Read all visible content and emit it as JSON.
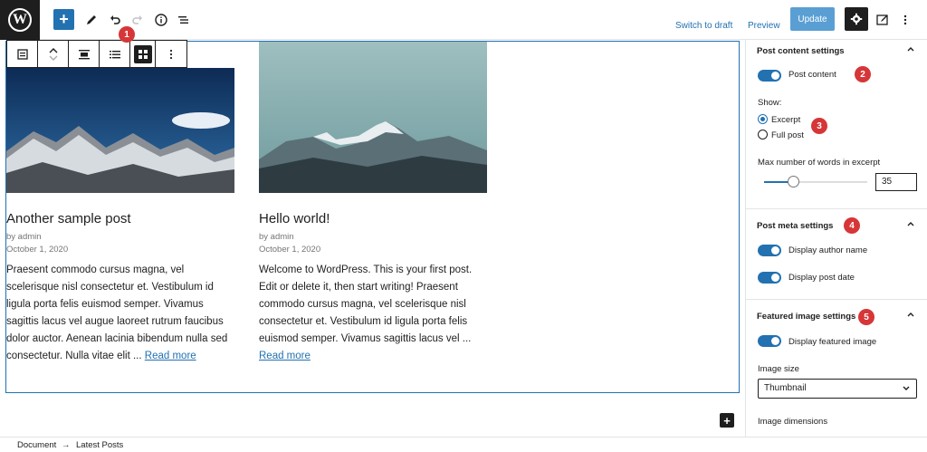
{
  "toolbar": {
    "add_label": "+",
    "switch_to_draft": "Switch to draft",
    "preview": "Preview",
    "update": "Update",
    "logo_letter": "W"
  },
  "posts": [
    {
      "title": "Another sample post",
      "author": "by admin",
      "date": "October 1, 2020",
      "excerpt": "Praesent commodo cursus magna, vel scelerisque nisl consectetur et. Vestibulum id ligula porta felis euismod semper. Vivamus sagittis lacus vel augue laoreet rutrum faucibus dolor auctor. Aenean lacinia bibendum nulla sed consectetur. Nulla vitae elit ... ",
      "read_more": "Read more"
    },
    {
      "title": "Hello world!",
      "author": "by admin",
      "date": "October 1, 2020",
      "excerpt": "Welcome to WordPress. This is your first post. Edit or delete it, then start writing! Praesent commodo cursus magna, vel scelerisque nisl consectetur et. Vestibulum id ligula porta felis euismod semper. Vivamus sagittis lacus vel ...",
      "read_more": "Read more"
    }
  ],
  "breadcrumb": {
    "root": "Document",
    "separator": "→",
    "current": "Latest Posts"
  },
  "sidebar": {
    "post_content": {
      "heading": "Post content settings",
      "toggle_label": "Post content",
      "show_label": "Show:",
      "options": [
        "Excerpt",
        "Full post"
      ],
      "selected": "Excerpt",
      "max_words_label": "Max number of words in excerpt",
      "max_words_value": "35",
      "max_words_fraction": 0.28
    },
    "post_meta": {
      "heading": "Post meta settings",
      "author_label": "Display author name",
      "date_label": "Display post date"
    },
    "featured_image": {
      "heading": "Featured image settings",
      "toggle_label": "Display featured image",
      "size_label": "Image size",
      "size_value": "Thumbnail",
      "dimensions_label": "Image dimensions"
    }
  },
  "badges": [
    "1",
    "2",
    "3",
    "4",
    "5"
  ],
  "colors": {
    "accent": "#2271b1",
    "badge": "#d63638",
    "dark": "#1e1e1e"
  }
}
